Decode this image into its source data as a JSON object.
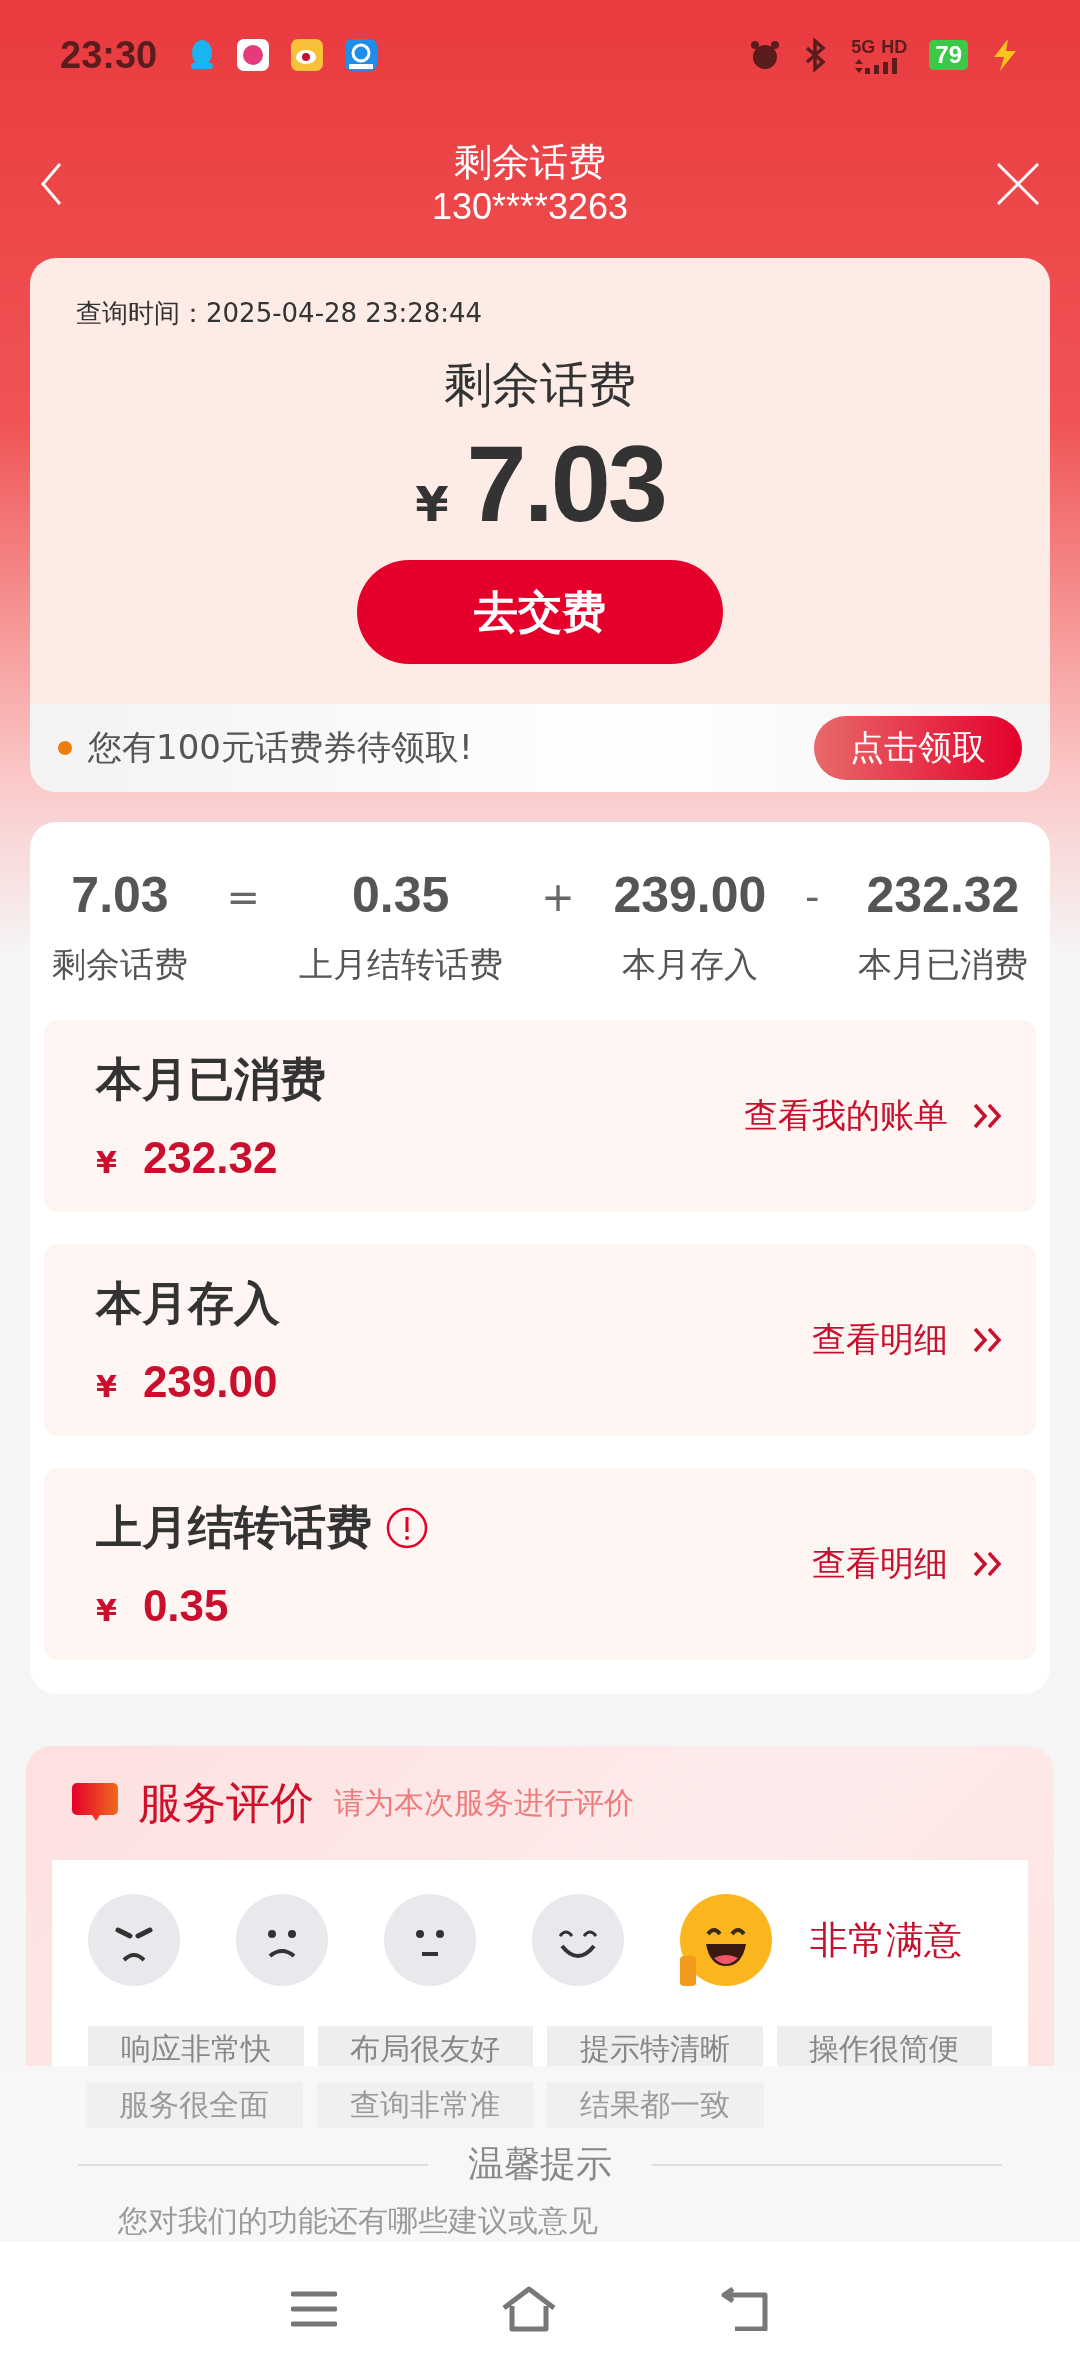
{
  "status_bar": {
    "time": "23:30",
    "network": "5G",
    "network_extra": "HD",
    "battery": "79"
  },
  "header": {
    "title": "剩余话费",
    "phone": "130****3263"
  },
  "balance_card": {
    "query_time": "查询时间：2025-04-28 23:28:44",
    "title": "剩余话费",
    "currency": "¥",
    "amount": "7.03",
    "pay_button": "去交费",
    "coupon": {
      "text": "您有100元话费券待领取!",
      "button": "点击领取"
    }
  },
  "breakdown": [
    {
      "kind": "term",
      "value": "7.03",
      "label": "剩余话费"
    },
    {
      "kind": "operator",
      "value": "="
    },
    {
      "kind": "term",
      "value": "0.35",
      "label": "上月结转话费"
    },
    {
      "kind": "operator",
      "value": "+"
    },
    {
      "kind": "term",
      "value": "239.00",
      "label": "本月存入"
    },
    {
      "kind": "operator",
      "value": "-"
    },
    {
      "kind": "term",
      "value": "232.32",
      "label": "本月已消费"
    }
  ],
  "details": [
    {
      "title": "本月已消费",
      "info": false,
      "currency": "¥",
      "amount": "232.32",
      "link": "查看我的账单"
    },
    {
      "title": "本月存入",
      "info": false,
      "currency": "¥",
      "amount": "239.00",
      "link": "查看明细"
    },
    {
      "title": "上月结转话费",
      "info": true,
      "currency": "¥",
      "amount": "0.35",
      "link": "查看明细"
    }
  ],
  "rating": {
    "title": "服务评价",
    "subtitle": "请为本次服务进行评价",
    "faces": [
      {
        "kind": "angry",
        "selected": false
      },
      {
        "kind": "sad",
        "selected": false
      },
      {
        "kind": "neutral",
        "selected": false
      },
      {
        "kind": "smile",
        "selected": false
      },
      {
        "kind": "laugh",
        "selected": true
      }
    ],
    "selected_label": "非常满意",
    "tags": [
      "响应非常快",
      "布局很友好",
      "提示特清晰",
      "操作很简便"
    ],
    "tags_under_sheet": [
      "服务很全面",
      "查询非常准",
      "结果都一致"
    ]
  },
  "sheet": {
    "title": "温馨提示",
    "text_under": "您对我们的功能还有哪些建议或意见"
  }
}
